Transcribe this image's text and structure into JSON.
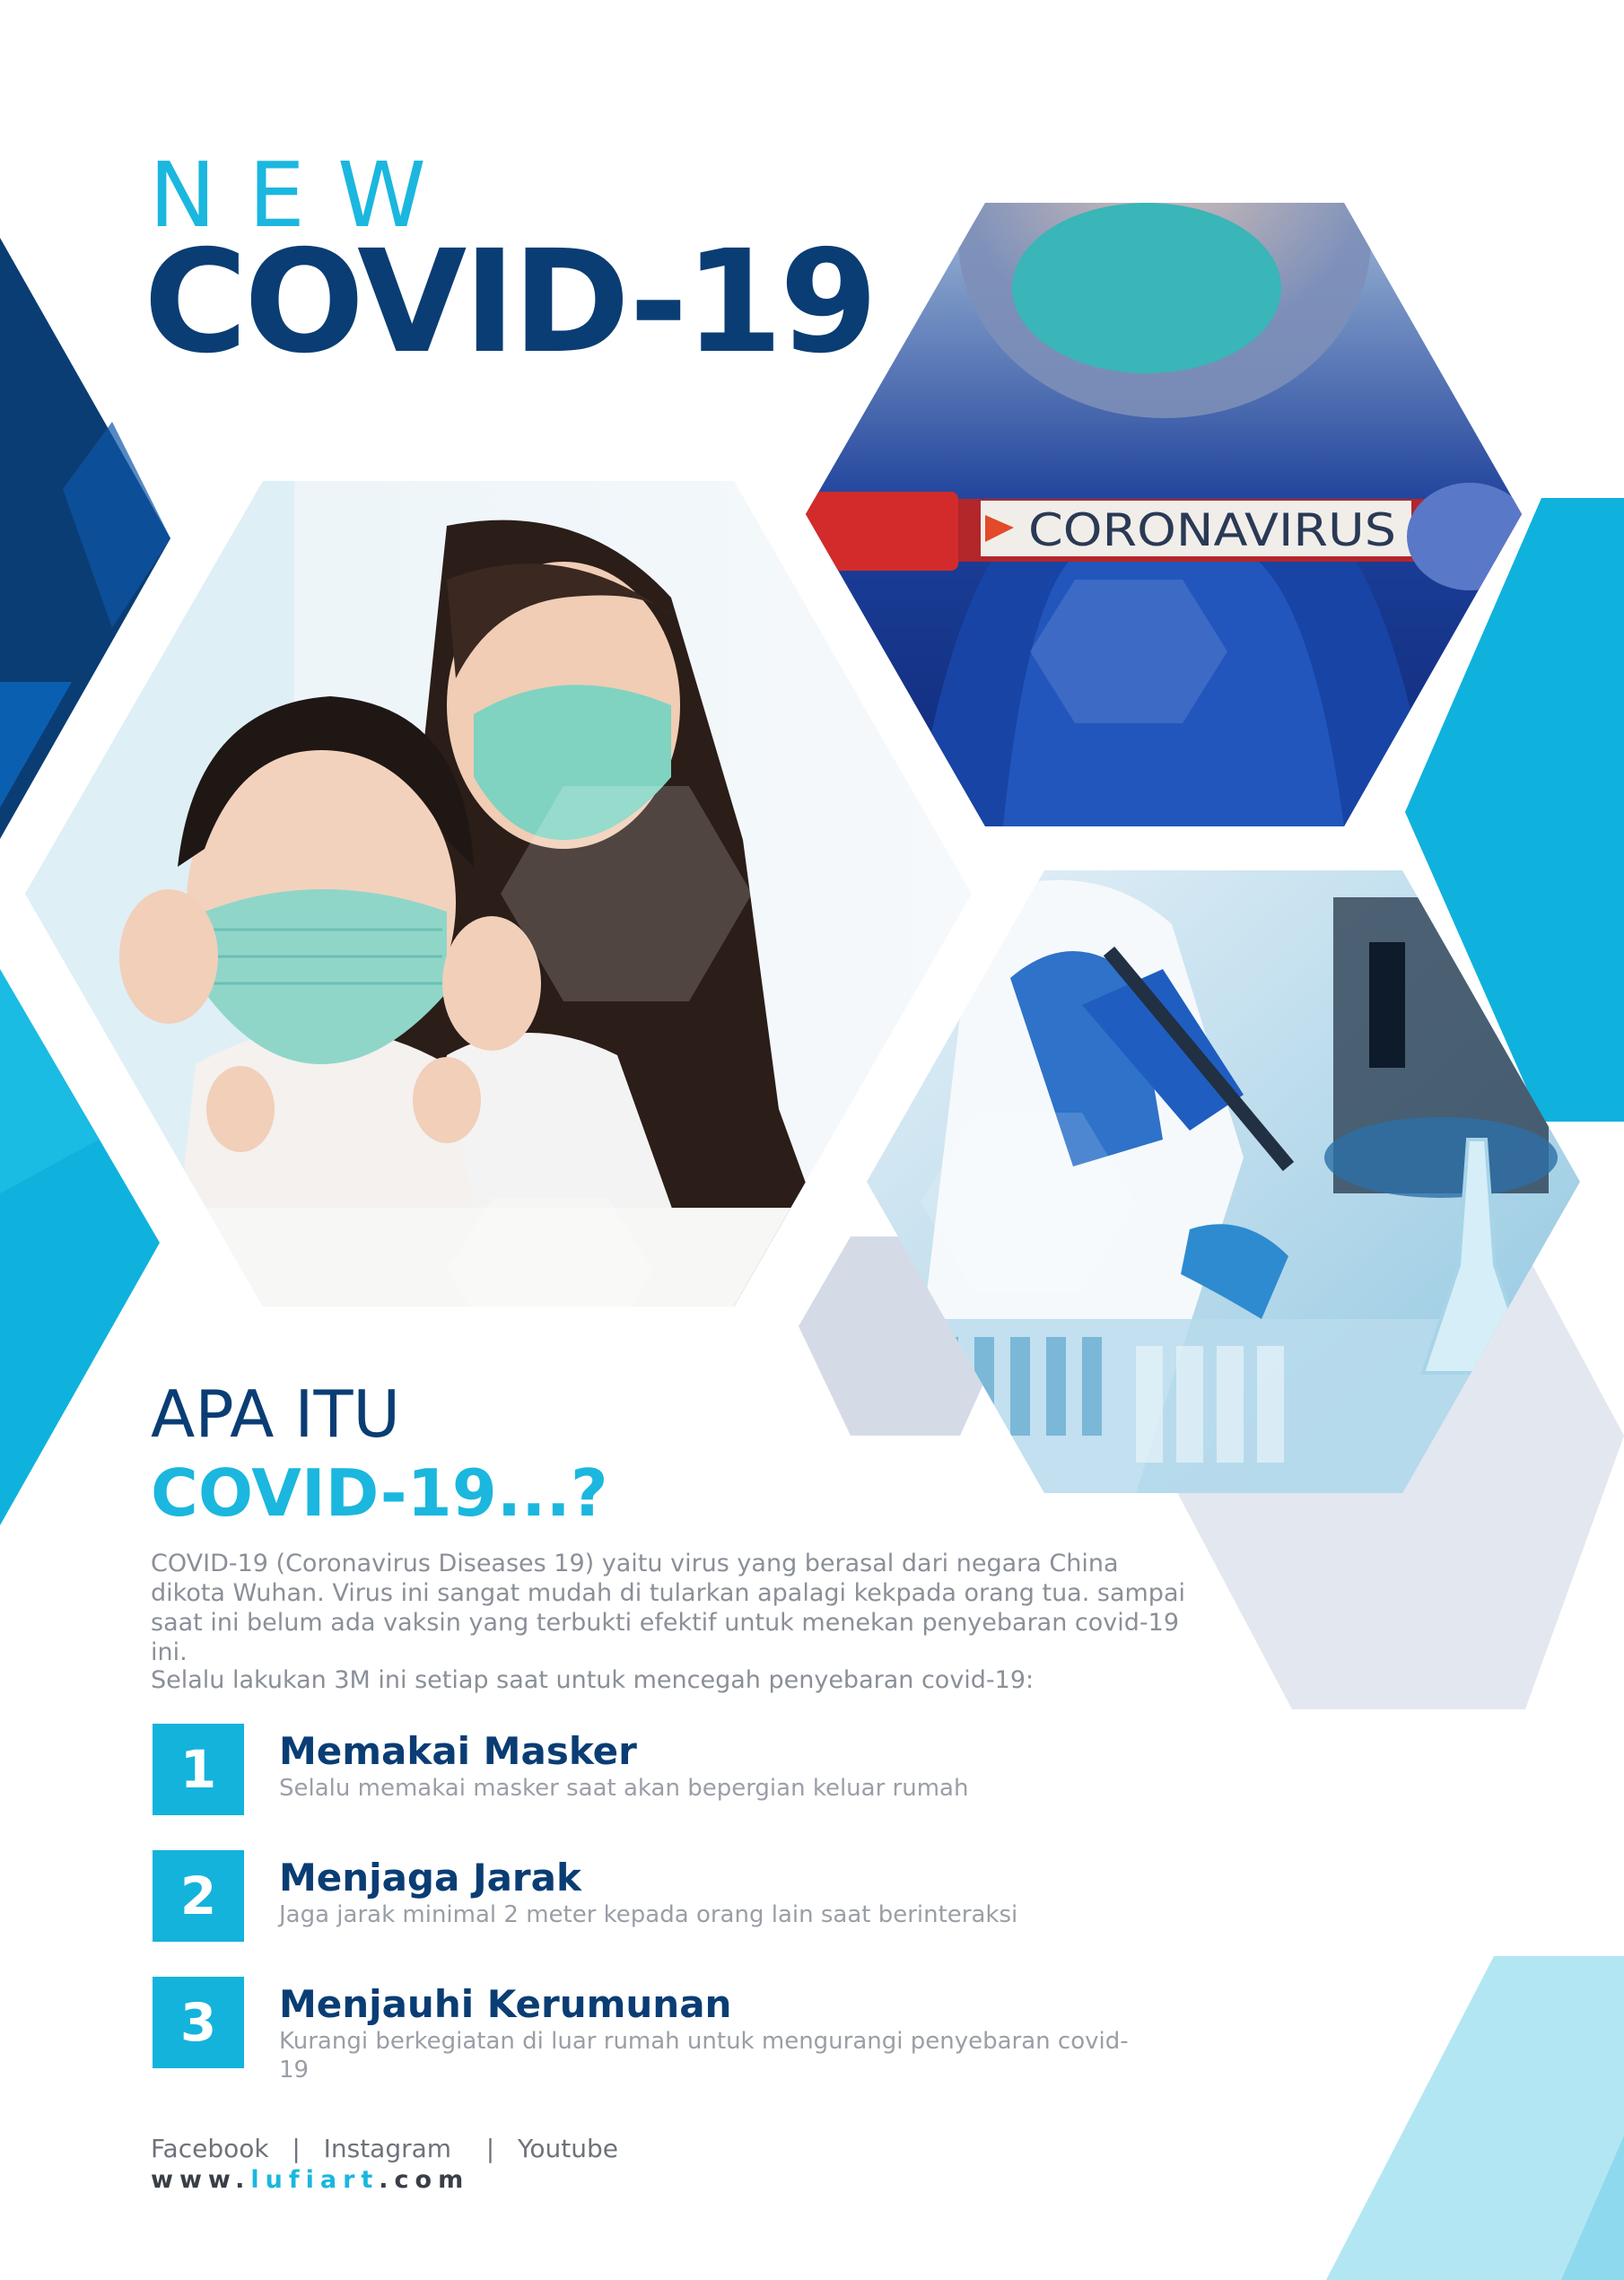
{
  "header": {
    "eyebrow": "NEW",
    "title": "COVID-19"
  },
  "photos": {
    "tube_label": "CORONAVIRUS"
  },
  "section": {
    "heading_line1": "APA ITU",
    "heading_line2": "COVID-19...?",
    "paragraph": "COVID-19 (Coronavirus Diseases 19) yaitu virus yang berasal dari negara China dikota Wuhan. Virus ini sangat mudah di  tularkan apalagi kekpada orang tua. sampai saat ini belum ada vaksin yang terbukti efektif untuk menekan penyebaran covid-19 ini.",
    "intro": "Selalu lakukan 3M ini setiap saat untuk mencegah penyebaran covid-19:"
  },
  "steps": [
    {
      "number": "1",
      "title": "Memakai Masker",
      "description": "Selalu memakai masker saat akan bepergian keluar rumah"
    },
    {
      "number": "2",
      "title": "Menjaga Jarak",
      "description": "Jaga jarak minimal 2 meter kepada orang lain saat berinteraksi"
    },
    {
      "number": "3",
      "title": "Menjauhi Kerumunan",
      "description": "Kurangi berkegiatan di luar rumah untuk mengurangi penyebaran covid-19"
    }
  ],
  "footer": {
    "social": "Facebook  |  Instagram   |  Youtube",
    "website_prefix": "www.",
    "website_brand": "lufiart",
    "website_suffix": ".com"
  },
  "colors": {
    "navy": "#0a3d74",
    "cyan": "#1bb7de",
    "light_cyan": "#b3e6f3",
    "grey_hex": "#e3e7ef"
  }
}
